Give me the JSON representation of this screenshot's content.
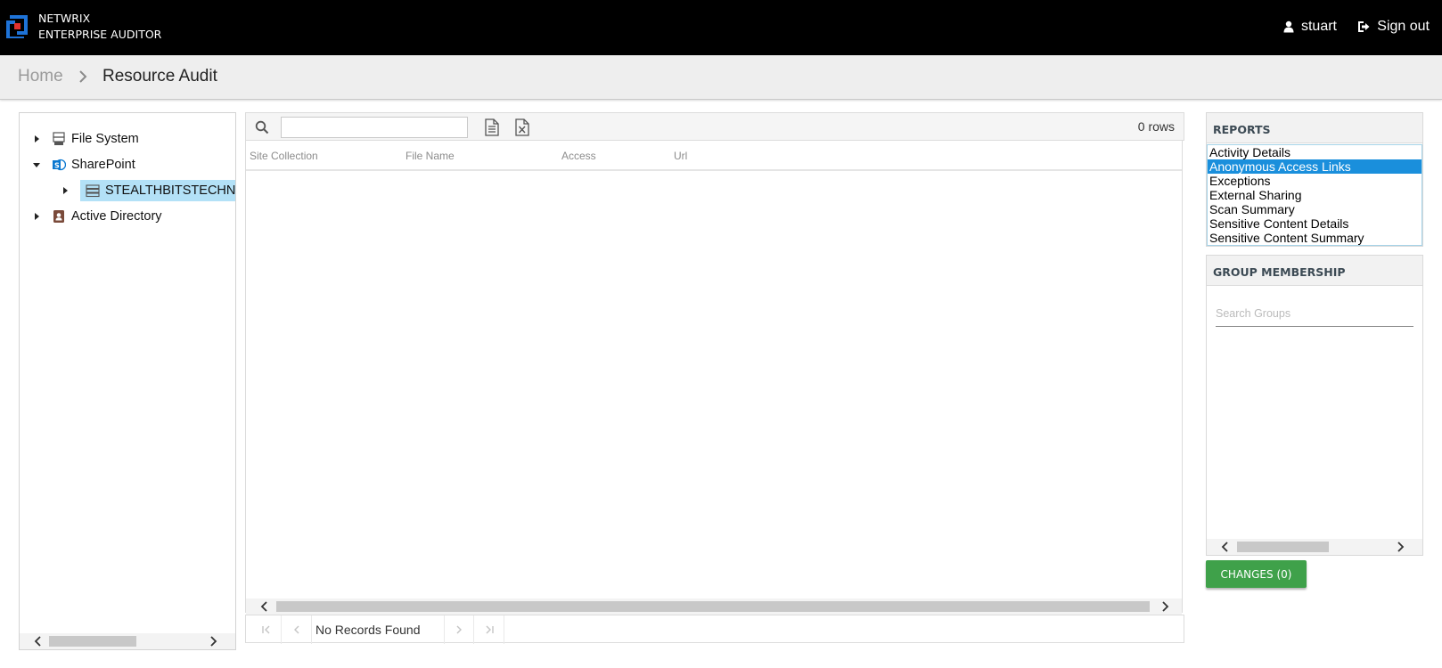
{
  "header": {
    "brand_line1": "NETWRIX",
    "brand_line2": "ENTERPRISE AUDITOR",
    "user_name": "stuart",
    "signout_label": "Sign out",
    "accent_color": "#1e73d8"
  },
  "breadcrumb": {
    "home": "Home",
    "current": "Resource Audit"
  },
  "tree": {
    "items": [
      {
        "label": "File System",
        "icon": "file-system-icon",
        "expanded": false
      },
      {
        "label": "SharePoint",
        "icon": "sharepoint-icon",
        "expanded": true
      },
      {
        "label": "STEALTHBITSTECHNO",
        "icon": "server-icon",
        "expanded": false,
        "selected": true
      },
      {
        "label": "Active Directory",
        "icon": "active-directory-icon",
        "expanded": false
      }
    ]
  },
  "grid": {
    "search_value": "",
    "row_count": "0 rows",
    "columns": [
      "Site Collection",
      "File Name",
      "Access",
      "Url"
    ],
    "rows": [],
    "pager_text": "No Records Found"
  },
  "reports": {
    "title": "REPORTS",
    "items": [
      "Activity Details",
      "Anonymous Access Links",
      "Exceptions",
      "External Sharing",
      "Scan Summary",
      "Sensitive Content Details",
      "Sensitive Content Summary"
    ],
    "selected": "Anonymous Access Links"
  },
  "groups": {
    "title": "GROUP MEMBERSHIP",
    "search_placeholder": "Search Groups"
  },
  "changes_button": "CHANGES (0)"
}
